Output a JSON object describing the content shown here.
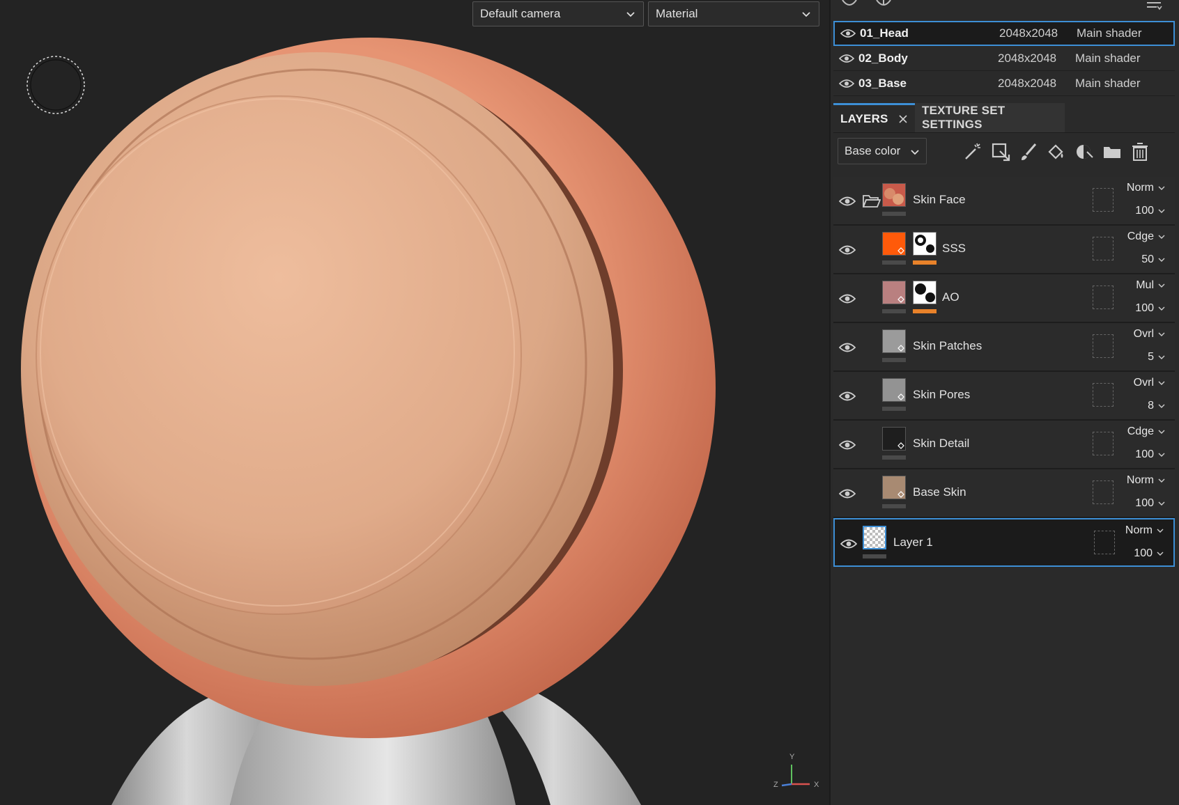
{
  "viewport": {
    "camera_select": "Default camera",
    "mode_select": "Material",
    "axis": {
      "y": "Y",
      "x": "X",
      "z": "Z"
    }
  },
  "texture_sets": [
    {
      "name": "01_Head",
      "size": "2048x2048",
      "shader": "Main shader",
      "selected": true
    },
    {
      "name": "02_Body",
      "size": "2048x2048",
      "shader": "Main shader",
      "selected": false
    },
    {
      "name": "03_Base",
      "size": "2048x2048",
      "shader": "Main shader",
      "selected": false
    }
  ],
  "tabs": {
    "layers": "LAYERS",
    "texture_set_settings": "TEXTURE SET SETTINGS"
  },
  "channel_select": "Base color",
  "tools": [
    "magic-wand-icon",
    "smart-material-icon",
    "paint-brush-icon",
    "fill-bucket-icon",
    "smart-mask-icon",
    "folder-icon",
    "trash-icon"
  ],
  "layers": [
    {
      "name": "Skin Face",
      "blend": "Norm",
      "opacity": "100",
      "color": "#c85a4a",
      "folder": true,
      "mask": false
    },
    {
      "name": "SSS",
      "blend": "Cdge",
      "opacity": "50",
      "color": "#ff5a0a",
      "folder": false,
      "mask": true
    },
    {
      "name": "AO",
      "blend": "Mul",
      "opacity": "100",
      "color": "#b98080",
      "folder": false,
      "mask": true
    },
    {
      "name": "Skin Patches",
      "blend": "Ovrl",
      "opacity": "5",
      "color": "#9b9b9b",
      "folder": false,
      "mask": false
    },
    {
      "name": "Skin Pores",
      "blend": "Ovrl",
      "opacity": "8",
      "color": "#939393",
      "folder": false,
      "mask": false
    },
    {
      "name": "Skin Detail",
      "blend": "Cdge",
      "opacity": "100",
      "color": "#1e1e1e",
      "folder": false,
      "mask": false
    },
    {
      "name": "Base Skin",
      "blend": "Norm",
      "opacity": "100",
      "color": "#a88a72",
      "folder": false,
      "mask": false
    },
    {
      "name": "Layer 1",
      "blend": "Norm",
      "opacity": "100",
      "color": "checker",
      "folder": false,
      "mask": false,
      "selected": true
    }
  ],
  "colors": {
    "accent": "#3d8fd6",
    "mask_bar": "#e8822a",
    "skin_outer": "#e4906e",
    "skin_inner": "#ddaa88"
  }
}
